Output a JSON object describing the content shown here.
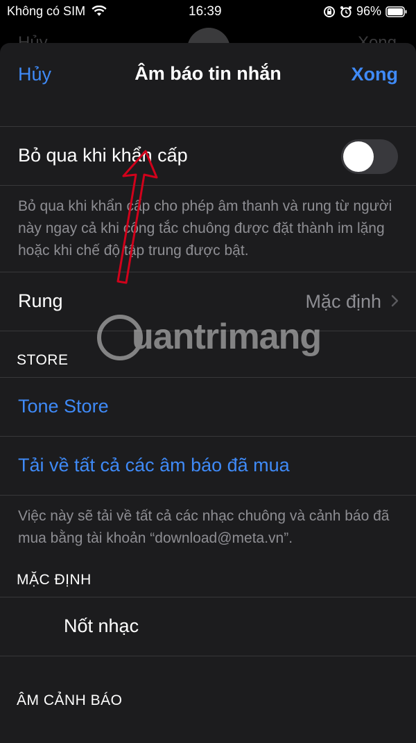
{
  "status_bar": {
    "carrier": "Không có SIM",
    "time": "16:39",
    "battery": "96%"
  },
  "background_nav": {
    "left": "Hủy",
    "right": "Xong"
  },
  "nav": {
    "cancel": "Hủy",
    "title": "Âm báo tin nhắn",
    "done": "Xong"
  },
  "emergency": {
    "label": "Bỏ qua khi khẩn cấp",
    "enabled": false,
    "footer": "Bỏ qua khi khẩn cấp cho phép âm thanh và rung từ người này ngay cả khi công tắc chuông được đặt thành im lặng hoặc khi chế độ tập trung được bật."
  },
  "vibration": {
    "label": "Rung",
    "value": "Mặc định"
  },
  "store": {
    "header": "STORE",
    "tone_store": "Tone Store",
    "download_all": "Tải về tất cả các âm báo đã mua",
    "footer": "Việc này sẽ tải về tất cả các nhạc chuông và cảnh báo đã mua bằng tài khoản “download@meta.vn”."
  },
  "default": {
    "header": "MẶC ĐỊNH",
    "item": "Nốt nhạc"
  },
  "next_section_header": "ÂM CẢNH BÁO",
  "watermark": "uantrimang",
  "colors": {
    "accent": "#3f8af7",
    "background": "#1c1c1e",
    "secondary_text": "#8e8e93",
    "annotation_arrow": "#d0021b"
  }
}
